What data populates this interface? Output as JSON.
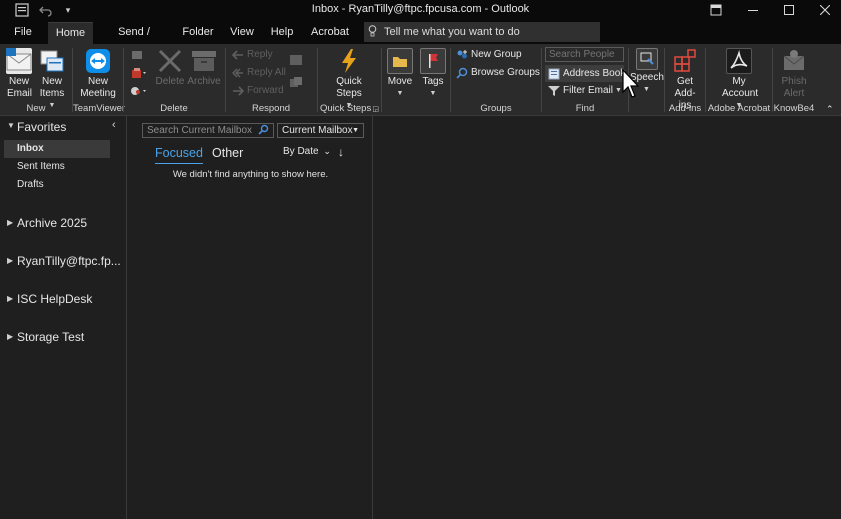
{
  "window": {
    "title": "Inbox - RyanTilly@ftpc.fpcusa.com  -  Outlook"
  },
  "tabs": [
    "File",
    "Home",
    "Send / Receive",
    "Folder",
    "View",
    "Help",
    "Acrobat"
  ],
  "active_tab": "Home",
  "tell_me": {
    "placeholder": "Tell me what you want to do"
  },
  "ribbon": {
    "new": {
      "new_email": "New Email",
      "new_items": "New Items",
      "label": "New"
    },
    "teamviewer": {
      "new_meeting": "New Meeting",
      "label": "TeamViewer"
    },
    "delete": {
      "delete": "Delete",
      "archive": "Archive",
      "label": "Delete"
    },
    "respond": {
      "reply": "Reply",
      "reply_all": "Reply All",
      "forward": "Forward",
      "label": "Respond"
    },
    "quick_steps": {
      "button": "Quick Steps",
      "label": "Quick Steps"
    },
    "move": {
      "move": "Move",
      "tags": "Tags"
    },
    "groups": {
      "new_group": "New Group",
      "browse_groups": "Browse Groups",
      "label": "Groups"
    },
    "find": {
      "search_people_placeholder": "Search People",
      "address_book": "Address Book",
      "filter_email": "Filter Email",
      "label": "Find"
    },
    "speech": {
      "button": "Speech"
    },
    "addins": {
      "get_addins": "Get Add-ins",
      "label": "Add-ins"
    },
    "adobe": {
      "my_account": "My Account",
      "label": "Adobe Acrobat"
    },
    "knowbe4": {
      "phish_alert": "Phish Alert",
      "label": "KnowBe4"
    }
  },
  "nav": {
    "favorites": "Favorites",
    "inbox": "Inbox",
    "sent_items": "Sent Items",
    "drafts": "Drafts",
    "accounts": [
      "Archive 2025",
      "RyanTilly@ftpc.fp...",
      "ISC HelpDesk",
      "Storage Test"
    ]
  },
  "message_list": {
    "search_placeholder": "Search Current Mailbox",
    "scope": "Current Mailbox",
    "focused": "Focused",
    "other": "Other",
    "sort": "By Date",
    "empty_text": "We didn't find anything to show here."
  },
  "colors": {
    "accent": "#2b88d8",
    "background": "#1f1f1f",
    "ribbon": "#2b2b2b",
    "titlebar": "#0a0a0a"
  }
}
